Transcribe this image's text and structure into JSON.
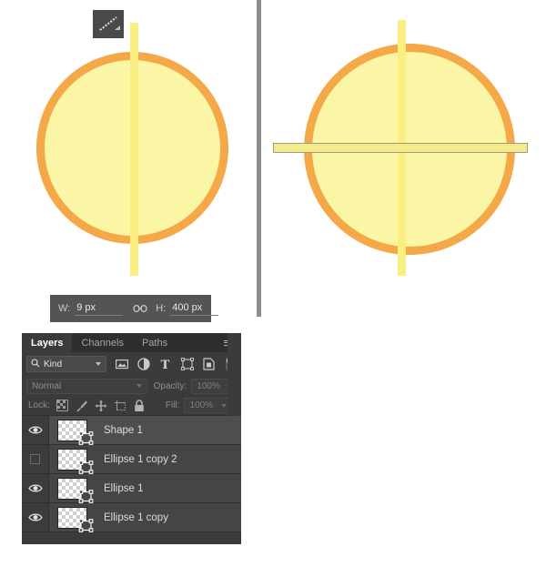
{
  "app": {
    "tool_badge_icon": "line-tool-icon"
  },
  "canvas": {
    "left": {
      "shape_fill": "#faf6a5",
      "shape_stroke": "#f5a847",
      "line_fill": "#fbef82"
    },
    "right": {
      "shape_fill": "#faf6a5",
      "shape_stroke": "#f5a847",
      "line_fill": "#fbef82",
      "bar_fill": "#f4ea8a",
      "bar_stroke": "#9a9a8f"
    }
  },
  "hud": {
    "width_label": "W:",
    "width_value": "9 px",
    "height_label": "H:",
    "height_value": "400 px",
    "link_icon": "link-chain-icon"
  },
  "layers_panel": {
    "tabs": [
      {
        "label": "Layers",
        "active": true
      },
      {
        "label": "Channels",
        "active": false
      },
      {
        "label": "Paths",
        "active": false
      }
    ],
    "menu_icon": "hamburger-menu-icon",
    "filter": {
      "search_icon": "search-icon",
      "kind_label": "Kind",
      "icons": [
        "pixel-layer-filter-icon",
        "adjustment-layer-filter-icon",
        "type-layer-filter-icon",
        "shape-layer-filter-icon",
        "smart-object-filter-icon"
      ],
      "toggle_icon": "filter-enable-toggle"
    },
    "blend": {
      "mode": "Normal",
      "opacity_label": "Opacity:",
      "opacity_value": "100%"
    },
    "lock": {
      "label": "Lock:",
      "icons": [
        "lock-transparent-pixels-icon",
        "lock-image-pixels-icon",
        "lock-position-icon",
        "lock-artboard-nesting-icon",
        "lock-all-icon"
      ],
      "fill_label": "Fill:",
      "fill_value": "100%"
    },
    "layers": [
      {
        "name": "Shape 1",
        "visible": true,
        "selected": true,
        "thumb_badge": "vector-mask-icon"
      },
      {
        "name": "Ellipse 1 copy 2",
        "visible": false,
        "selected": false,
        "thumb_badge": "vector-mask-icon"
      },
      {
        "name": "Ellipse 1",
        "visible": true,
        "selected": false,
        "thumb_badge": "vector-mask-icon"
      },
      {
        "name": "Ellipse 1 copy",
        "visible": true,
        "selected": false,
        "thumb_badge": "vector-mask-icon"
      }
    ]
  }
}
